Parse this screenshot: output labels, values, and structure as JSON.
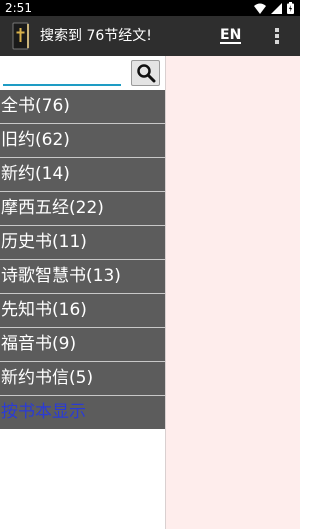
{
  "status_bar": {
    "time": "2:51",
    "icons": [
      "wifi-icon",
      "cellular-icon",
      "battery-icon"
    ]
  },
  "app_bar": {
    "title": "搜索到 76节经文!",
    "lang_label": "EN",
    "icons": [
      "bible-icon",
      "more-vert-icon"
    ]
  },
  "search": {
    "value": "",
    "placeholder": "",
    "icon": "search-icon"
  },
  "filters": [
    {
      "label": "全书(76)"
    },
    {
      "label": "旧约(62)"
    },
    {
      "label": "新约(14)"
    },
    {
      "label": "摩西五经(22)"
    },
    {
      "label": "历史书(11)"
    },
    {
      "label": "诗歌智慧书(13)"
    },
    {
      "label": "先知书(16)"
    },
    {
      "label": "福音书(9)"
    },
    {
      "label": "新约书信(5)"
    }
  ],
  "show_by_book_link": "按书本显示",
  "colors": {
    "app_bar": "#2e2e2e",
    "filter_bg": "#5c5c5c",
    "link": "#2a3bd6",
    "content_bg": "#feedec",
    "input_underline": "#1e9cc4"
  }
}
